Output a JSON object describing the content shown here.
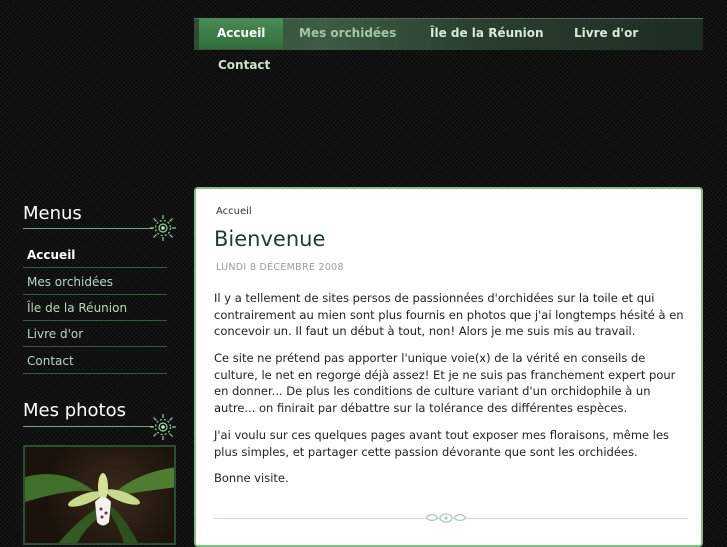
{
  "nav": {
    "tabs": [
      {
        "label": "Accueil",
        "active": true
      },
      {
        "label": "Mes orchidées",
        "active": false
      },
      {
        "label": "Île de la Réunion",
        "active": false
      },
      {
        "label": "Livre d'or",
        "active": false
      },
      {
        "label": "Contact",
        "active": false
      }
    ]
  },
  "sidebar": {
    "menus_title": "Menus",
    "items": [
      {
        "label": "Accueil",
        "active": true
      },
      {
        "label": "Mes orchidées",
        "active": false
      },
      {
        "label": "Île de la Réunion",
        "active": false
      },
      {
        "label": "Livre d'or",
        "active": false
      },
      {
        "label": "Contact",
        "active": false
      }
    ],
    "photos_title": "Mes photos"
  },
  "content": {
    "breadcrumb": "Accueil",
    "title": "Bienvenue",
    "date": "LUNDI 8 DÉCEMBRE 2008",
    "paragraphs": [
      "Il y a tellement de sites persos de passionnées d'orchidées sur la toile et qui contrairement au mien sont plus fournis en photos que j'ai longtemps hésité à en concevoir un. Il faut un début à tout, non! Alors je me suis mis au travail.",
      "Ce site ne prétend pas apporter l'unique voie(x) de la vérité en conseils de culture, le net en regorge déjà assez! Et je ne suis pas franchement expert pour en donner... De plus les conditions de culture variant d'un orchidophile à un autre... on finirait par débattre sur la tolérance des différentes espèces.",
      "J'ai voulu sur ces quelques pages avant tout exposer mes floraisons, même les plus simples, et partager cette passion dévorante que sont les orchidées.",
      "Bonne visite."
    ]
  },
  "colors": {
    "accent": "#4a8d55",
    "panel_border": "#7dbf86",
    "background": "#0b0b0b"
  },
  "icons": [
    "sun-ornament-icon",
    "leaf-ornament-icon"
  ]
}
